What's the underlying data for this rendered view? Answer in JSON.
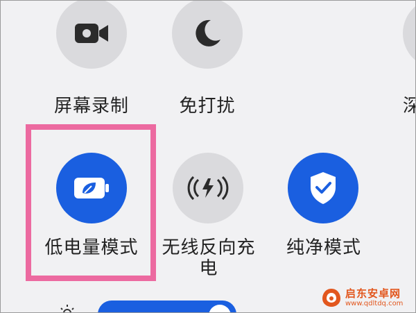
{
  "tiles": {
    "screen_record": {
      "label": "屏幕录制",
      "icon": "video-camera-icon",
      "active": false
    },
    "do_not_disturb": {
      "label": "免打扰",
      "icon": "moon-icon",
      "active": false
    },
    "deep_partial": {
      "label": "深",
      "active": false
    },
    "low_power": {
      "label": "低电量模式",
      "icon": "battery-leaf-icon",
      "active": true
    },
    "wireless_reverse": {
      "label_line1": "无线反向充",
      "label_line2": "电",
      "icon": "wireless-charge-icon",
      "active": false
    },
    "pure_mode": {
      "label": "纯净模式",
      "icon": "shield-check-icon",
      "active": true
    }
  },
  "brightness": {
    "icon": "sun-icon"
  },
  "watermark": {
    "title": "启东安卓网",
    "url": "www.qdltdq.com"
  },
  "colors": {
    "accent": "#1a5fe0",
    "tile_off": "#dadadd",
    "highlight": "#ec6aa0",
    "watermark": "#e2571e"
  }
}
